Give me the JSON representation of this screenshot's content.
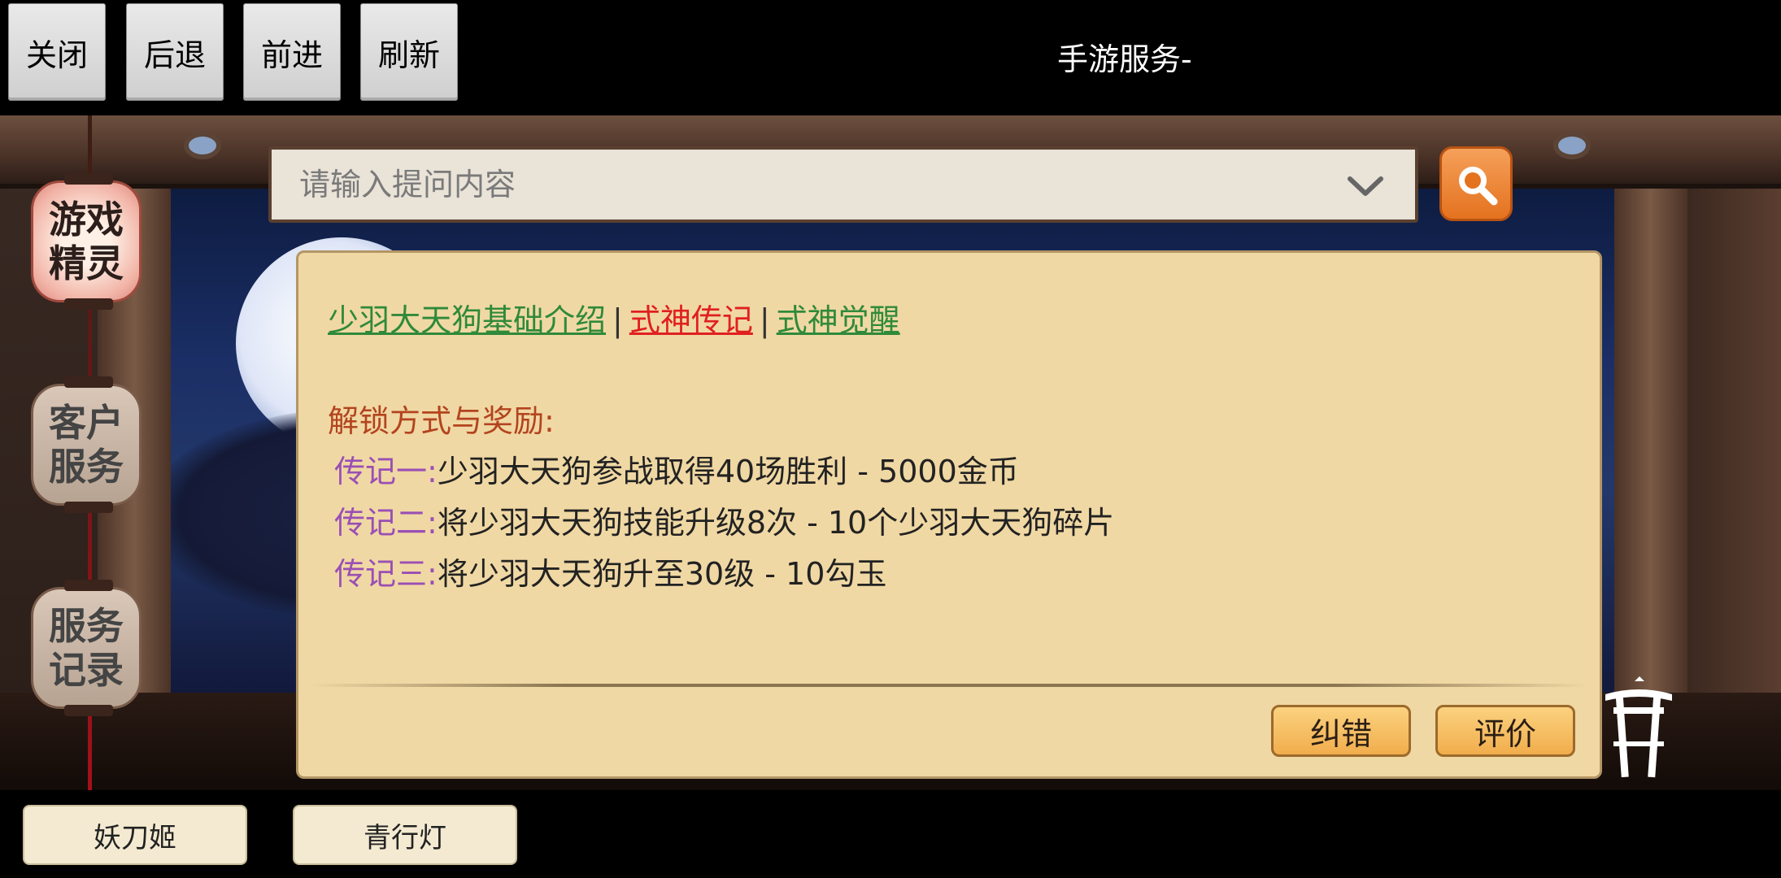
{
  "toolbar": {
    "close_label": "关闭",
    "back_label": "后退",
    "forward_label": "前进",
    "refresh_label": "刷新",
    "title": "手游服务-"
  },
  "sidebar": {
    "items": [
      {
        "label": "游戏精灵",
        "active": true
      },
      {
        "label": "客户服务",
        "active": false
      },
      {
        "label": "服务记录",
        "active": false
      }
    ]
  },
  "search": {
    "placeholder": "请输入提问内容",
    "dropdown_icon": "chevron-down-icon",
    "button_icon": "search-icon"
  },
  "panel": {
    "links": [
      {
        "label": "少羽大天狗基础介绍",
        "color": "#2f8a3a"
      },
      {
        "label": "式神传记",
        "color": "#e02020"
      },
      {
        "label": "式神觉醒",
        "color": "#2f8a3a"
      }
    ],
    "separator": "|",
    "section_title": "解锁方式与奖励:",
    "rows": [
      {
        "label": "传记一:",
        "text": "少羽大天狗参战取得40场胜利 - 5000金币"
      },
      {
        "label": "传记二:",
        "text": "将少羽大天狗技能升级8次 - 10个少羽大天狗碎片"
      },
      {
        "label": "传记三:",
        "text": "将少羽大天狗升至30级 - 10勾玉"
      }
    ],
    "correct_label": "纠错",
    "rate_label": "评价"
  },
  "bottom": {
    "items": [
      "妖刀姬",
      "青行灯"
    ]
  },
  "colors": {
    "panel_bg": "#f0d8a4",
    "accent_orange": "#e4721f",
    "label_purple": "#9a4fb4",
    "section_red": "#b3441f"
  }
}
